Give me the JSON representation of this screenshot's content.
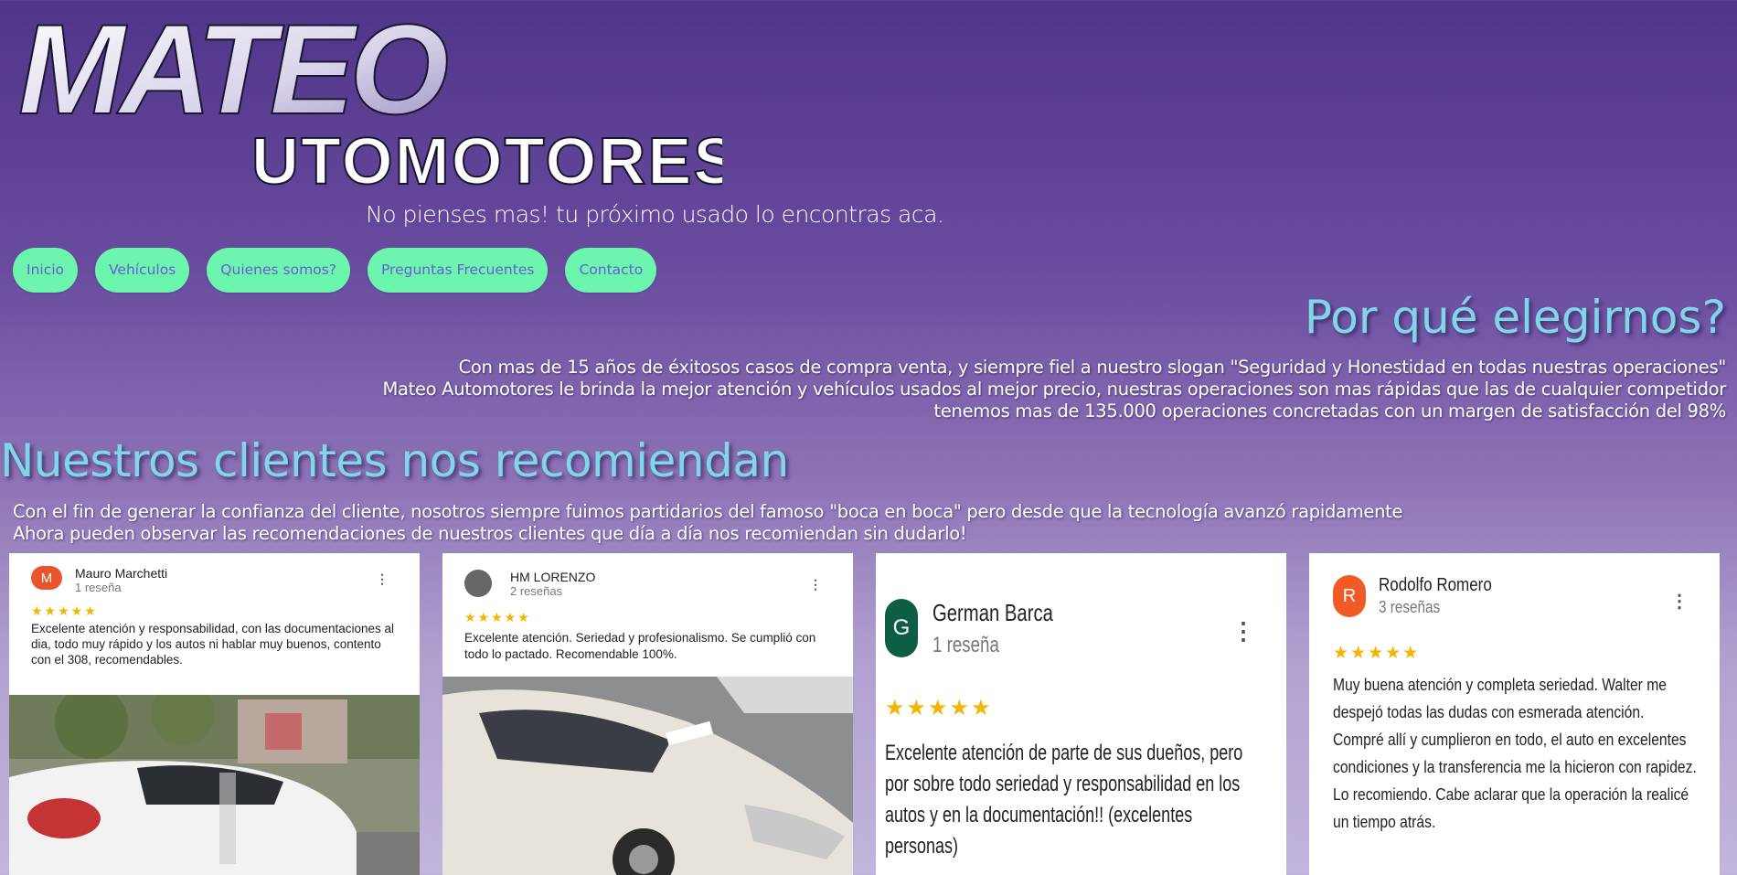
{
  "logo": {
    "line1": "MATEO",
    "line2": "UTOMOTORES"
  },
  "tagline": "No pienses mas! tu próximo usado lo encontras aca.",
  "nav": [
    "Inicio",
    "Vehículos",
    "Quienes somos?",
    "Preguntas Frecuentes",
    "Contacto"
  ],
  "why": {
    "title": "Por qué elegirnos?",
    "lines": [
      "Con mas de 15 años de éxitosos casos de compra venta, y siempre fiel a nuestro slogan \"Seguridad y Honestidad en todas nuestras operaciones\"",
      "Mateo Automotores le brinda la mejor atención y vehículos usados al mejor precio, nuestras operaciones son mas rápidas que las de cualquier competidor",
      "tenemos mas de 135.000 operaciones concretadas con un margen de satisfacción del 98%"
    ]
  },
  "recommend": {
    "title": "Nuestros clientes nos recomiendan",
    "lines": [
      "Con el fin de generar la confianza del cliente, nosotros siempre fuimos partidarios del famoso \"boca en boca\" pero desde que la tecnología avanzó rapidamente",
      "Ahora pueden observar las recomendaciones de nuestros clientes que día a día nos recomiendan sin dudarlo!"
    ]
  },
  "reviews": [
    {
      "initial": "M",
      "avatar_color": "#e8542c",
      "name": "Mauro Marchetti",
      "count": "1 reseña",
      "stars": "★★★★★",
      "text": "Excelente atención y responsabilidad, con las documentaciones al dia, todo muy rápido y los autos ni hablar muy buenos, contento con el 308, recomendables."
    },
    {
      "initial": "",
      "avatar_color": "#666666",
      "name": "HM LORENZO",
      "count": "2 reseñas",
      "stars": "★★★★★",
      "text": "Excelente atención. Seriedad y profesionalismo. Se cumplió con todo lo pactado. Recomendable 100%."
    },
    {
      "initial": "G",
      "avatar_color": "#0d5e45",
      "name": "German Barca",
      "count": "1 reseña",
      "stars": "★★★★★",
      "text": "Excelente atención de parte de sus dueños, pero por sobre todo seriedad y responsabilidad en los autos y en la documentación!! (excelentes personas)"
    },
    {
      "initial": "R",
      "avatar_color": "#f05a24",
      "name": "Rodolfo Romero",
      "count": "3 reseñas",
      "stars": "★★★★★",
      "text": "Muy buena atención y completa seriedad. Walter me despejó todas las dudas con esmerada atención. Compré allí y cumplieron en todo, el auto en excelentes condiciones y la transferencia me la hicieron con rapidez. Lo recomiendo. Cabe aclarar que la operación la realicé un tiempo atrás."
    }
  ],
  "colors": {
    "nav_bg": "#6cf5ad",
    "nav_text": "#6a5bd8",
    "heading": "#7fd6e9",
    "star": "#f4b400"
  }
}
